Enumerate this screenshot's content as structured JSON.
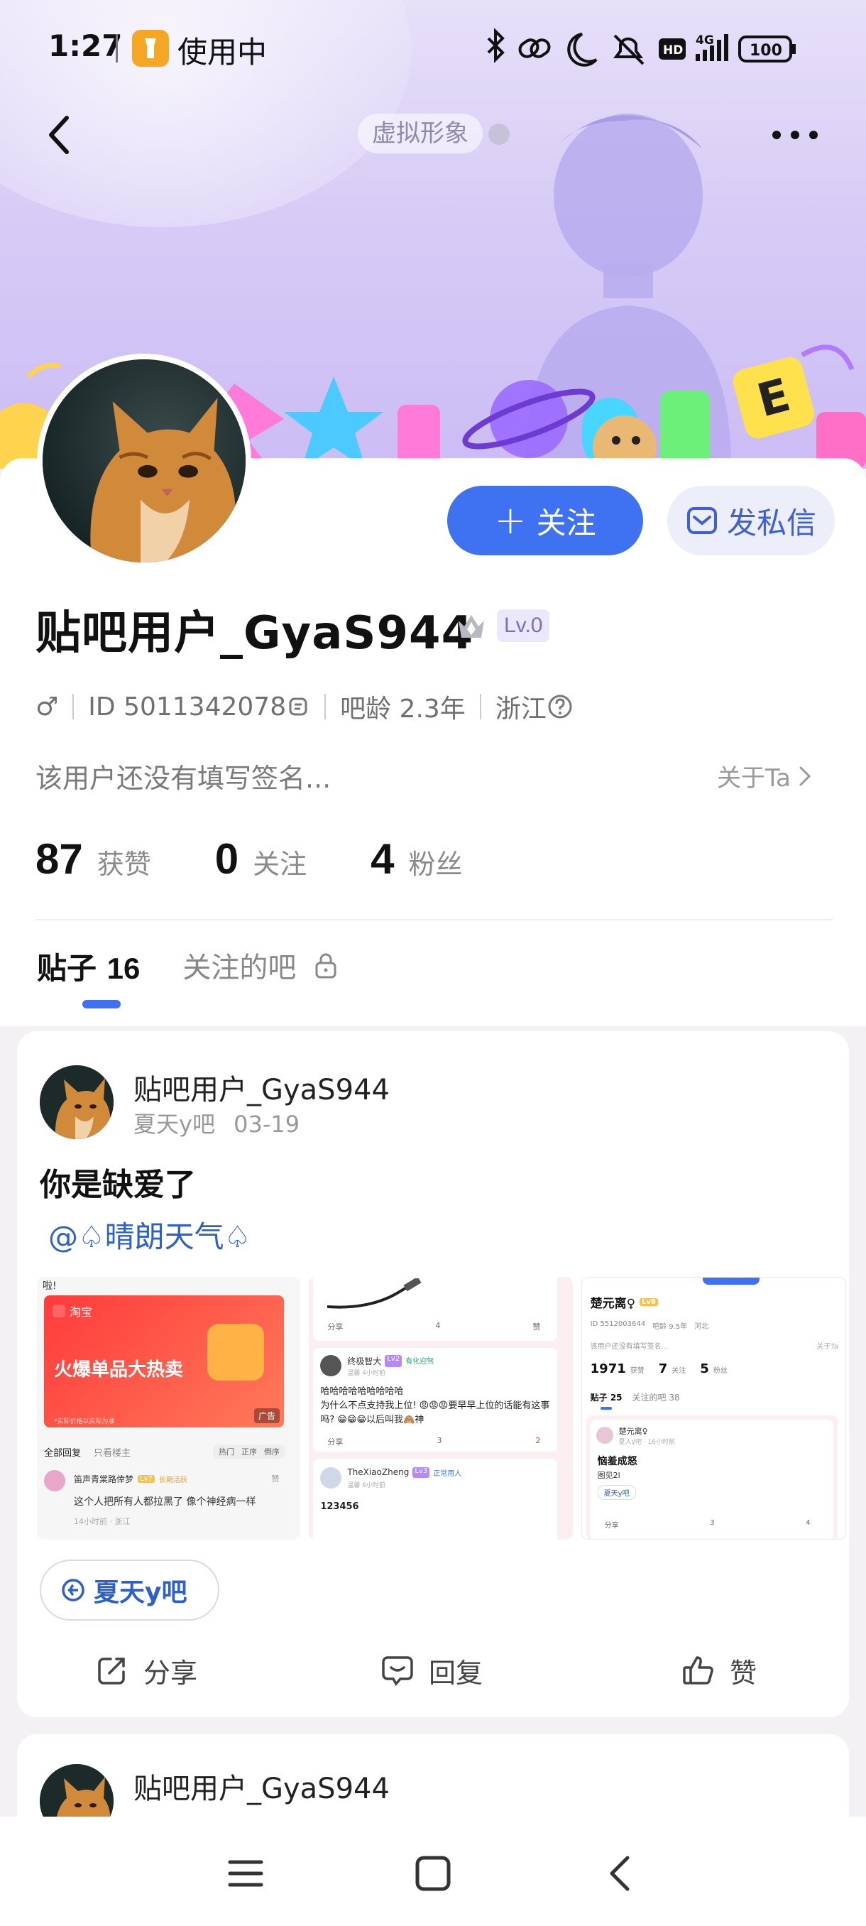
{
  "statusbar": {
    "time": "1:27",
    "in_use": "使用中",
    "battery": "100",
    "network": "4G",
    "hd": "HD"
  },
  "nav": {
    "virtual_image": "虚拟形象"
  },
  "profile": {
    "follow_label": "关注",
    "message_label": "发私信",
    "username": "贴吧用户_GyaS944",
    "level": "Lv.0",
    "gender": "♂",
    "id_text": "ID 5011342078",
    "bar_age": "吧龄 2.3年",
    "location": "浙江",
    "signature": "该用户还没有填写签名...",
    "about_label": "关于Ta",
    "stats": [
      {
        "value": "87",
        "label": "获赞"
      },
      {
        "value": "0",
        "label": "关注"
      },
      {
        "value": "4",
        "label": "粉丝"
      }
    ]
  },
  "tabs": {
    "posts_label": "贴子",
    "posts_count": "16",
    "liked_bars_label": "关注的吧"
  },
  "posts": [
    {
      "author": "贴吧用户_GyaS944",
      "bar": "夏天y吧",
      "date": "03-19",
      "title": "你是缺爱了",
      "mention": "@♤晴朗天气♤",
      "bar_chip": "夏天y吧",
      "actions": {
        "share": "分享",
        "reply": "回复",
        "like": "赞"
      },
      "thumb1": {
        "top_text": "啦!",
        "shop": "淘宝",
        "ad_text": "火爆单品大热卖",
        "ad_small": "*实际价格以实际为准",
        "ad_badge": "广告",
        "tabs": [
          "全部回复",
          "只看楼主",
          "热门",
          "正序",
          "倒序"
        ],
        "reply_user": "笛声青棠路倖梦",
        "reply_level": "Lv7",
        "reply_tag": "长期活跃",
        "reply_like": "赞",
        "reply_text": "这个人把所有人都拉黑了 像个神经病一样",
        "reply_time": "14小时前 · 浙江"
      },
      "thumb2": {
        "share": "分享",
        "reply_count": "4",
        "like": "赞",
        "user1": "终极智大",
        "user1_level": "Lv2",
        "user1_tag": "有化迎驾",
        "user1_time": "温馨 4小时前",
        "text1": "哈哈哈哈哈哈哈哈哈",
        "text2": "为什么不点支持我上位! 😡😡😡要早早上位的话能有这事吗? 😁😁😁以后叫我🙈神",
        "share2": "分享",
        "reply2": "3",
        "like2": "2",
        "user2": "TheXiaoZheng",
        "user2_level": "Lv3",
        "user2_tag": "正常用人",
        "user2_time": "温馨 6小时前",
        "text3": "123456"
      },
      "thumb3": {
        "name": "楚元离♀",
        "level": "Lv8",
        "id": "ID 5512003644",
        "age": "吧龄 9.5年",
        "loc": "河北",
        "sign": "该用户还没有填写签名...",
        "about": "关于Ta",
        "stat1": "1971",
        "stat1_label": "获赞",
        "stat2": "7",
        "stat2_label": "关注",
        "stat3": "5",
        "stat3_label": "粉丝",
        "tab1": "贴子 25",
        "tab2": "关注的吧 38",
        "post_user": "楚元离♀",
        "post_time": "夏人y吧 · 16小时前",
        "post_title": "恼羞成怒",
        "post_body": "图见2l",
        "post_chip": "夏天y吧",
        "share": "分享",
        "reply": "3",
        "like": "4"
      }
    },
    {
      "author": "贴吧用户_GyaS944"
    }
  ],
  "colors": {
    "accent": "#3f72f0",
    "mention": "#2c5fcf",
    "banner_top": "#e7e0f8",
    "banner_bottom": "#cbbcf4"
  }
}
